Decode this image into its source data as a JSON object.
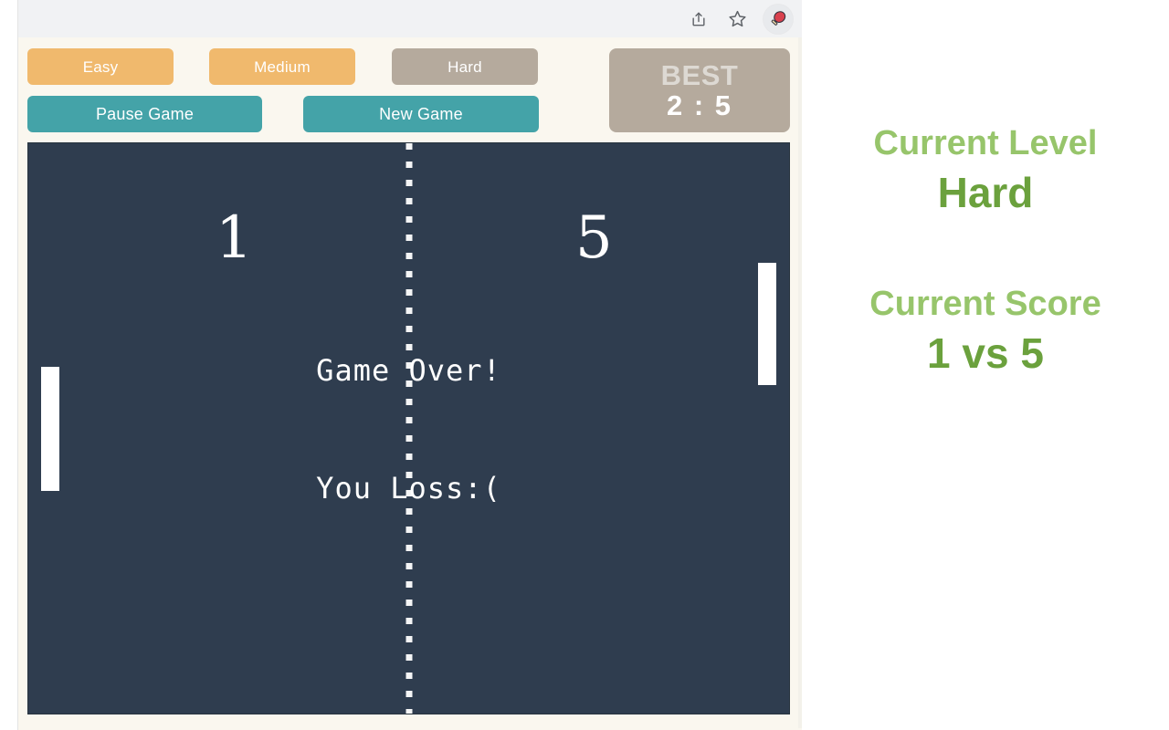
{
  "browser": {
    "toolbar": {
      "share_icon": "share-icon",
      "bookmark_icon": "star-icon",
      "extension_icon": "ping-pong-paddle-icon",
      "extension_title": "Ping Pong"
    }
  },
  "controls": {
    "levels": [
      {
        "id": "easy",
        "label": "Easy",
        "color": "#f0b96d",
        "active": false
      },
      {
        "id": "medium",
        "label": "Medium",
        "color": "#f0b96d",
        "active": false
      },
      {
        "id": "hard",
        "label": "Hard",
        "color": "#b5aa9d",
        "active": true
      }
    ],
    "actions": [
      {
        "id": "pause",
        "label": "Pause Game",
        "color": "#44a3a8"
      },
      {
        "id": "new",
        "label": "New Game",
        "color": "#44a3a8"
      }
    ],
    "best": {
      "label": "BEST",
      "value": "2 : 5",
      "box_color": "#b5aa9d"
    }
  },
  "board": {
    "background": "#2f3d4f",
    "score_left": "1",
    "score_right": "5",
    "message_main": "Game Over!",
    "message_sub": "You Loss:(",
    "paddle_color": "#ffffff",
    "net_color": "#ffffff"
  },
  "info": {
    "level": {
      "title": "Current Level",
      "value": "Hard"
    },
    "score": {
      "title": "Current Score",
      "value": "1 vs 5"
    },
    "title_color": "#97c56b",
    "value_color": "#6ba13d"
  }
}
